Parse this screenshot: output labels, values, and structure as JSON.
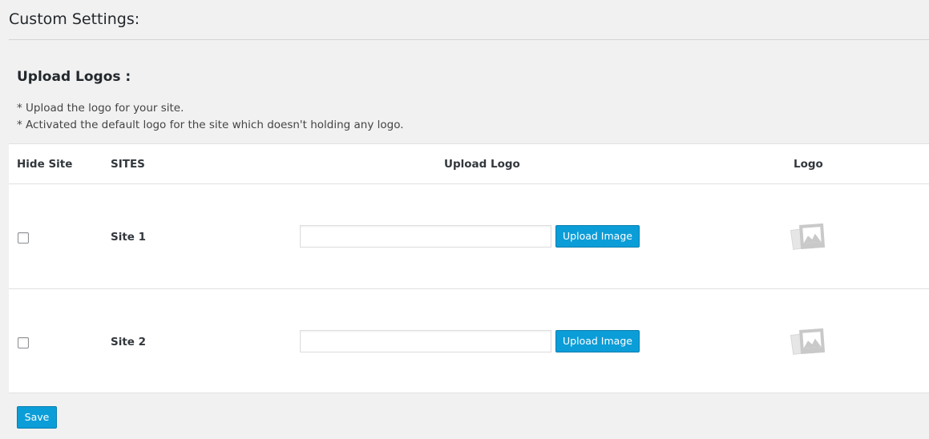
{
  "page": {
    "title": "Custom Settings:"
  },
  "section": {
    "heading": "Upload Logos :",
    "notes": [
      "* Upload the logo for your site.",
      "* Activated the default logo for the site which doesn't holding any logo."
    ]
  },
  "table": {
    "headers": {
      "hide_site": "Hide Site",
      "sites": "SITES",
      "upload_logo": "Upload Logo",
      "logo": "Logo"
    },
    "rows": [
      {
        "hidden": false,
        "site": "Site 1",
        "logo_value": "",
        "upload_label": "Upload Image",
        "logo_icon": "image-placeholder-icon"
      },
      {
        "hidden": false,
        "site": "Site 2",
        "logo_value": "",
        "upload_label": "Upload Image",
        "logo_icon": "image-placeholder-icon"
      }
    ]
  },
  "actions": {
    "save_label": "Save"
  },
  "colors": {
    "background": "#f1f1f1",
    "panel": "#ffffff",
    "button_primary": "#0b9dd8",
    "border": "#e1e1e1"
  }
}
